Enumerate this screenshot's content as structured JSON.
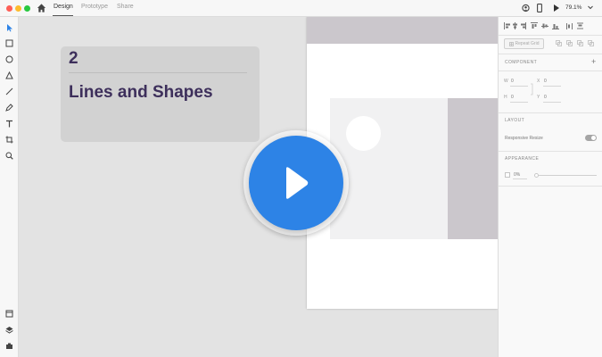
{
  "window": {
    "traffic_lights": [
      "#fe5f57",
      "#febc2e",
      "#28c840"
    ]
  },
  "header": {
    "tabs": [
      {
        "label": "Design",
        "active": true
      },
      {
        "label": "Prototype",
        "active": false
      },
      {
        "label": "Share",
        "active": false
      }
    ],
    "zoom": "79.1%"
  },
  "toolbar": {
    "tools": [
      "select-tool",
      "rectangle-tool",
      "ellipse-tool",
      "polygon-tool",
      "line-tool",
      "pen-tool",
      "text-tool",
      "artboard-tool",
      "zoom-tool"
    ],
    "bottom_tools": [
      "assets-panel",
      "layers-panel",
      "plugins-panel"
    ]
  },
  "lesson": {
    "number": "2",
    "title": "Lines and Shapes",
    "title_color": "#3d2f5b"
  },
  "play": {
    "color": "#2d83e6"
  },
  "panel": {
    "repeat_grid_label": "Repeat Grid",
    "component_label": "COMPONENT",
    "component_add": "+",
    "fields": {
      "w_label": "W",
      "w_value": "0",
      "x_label": "X",
      "x_value": "0",
      "h_label": "H",
      "h_value": "0",
      "y_label": "Y",
      "y_value": "0"
    },
    "layout_label": "LAYOUT",
    "responsive_resize_label": "Responsive Resize",
    "responsive_resize_on": true,
    "appearance_label": "APPEARANCE",
    "opacity_value": "0%"
  }
}
